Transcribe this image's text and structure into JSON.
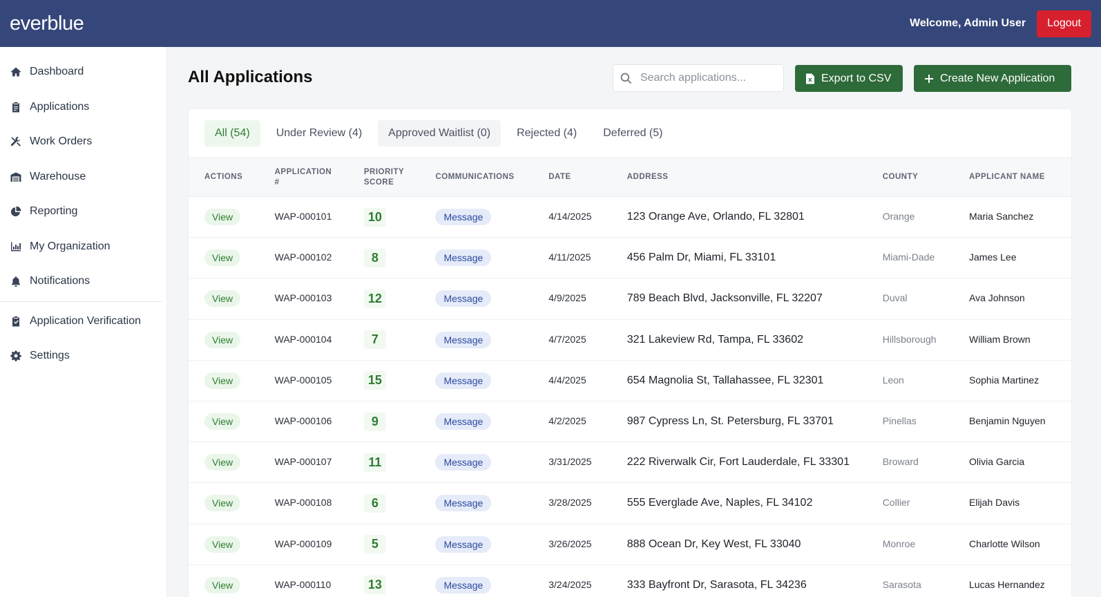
{
  "header": {
    "logo": "everblue",
    "welcome": "Welcome, Admin User",
    "logout_label": "Logout"
  },
  "sidebar": {
    "items": [
      {
        "label": "Dashboard",
        "icon": "home-icon"
      },
      {
        "label": "Applications",
        "icon": "clipboard-icon"
      },
      {
        "label": "Work Orders",
        "icon": "tools-icon"
      },
      {
        "label": "Warehouse",
        "icon": "warehouse-icon"
      },
      {
        "label": "Reporting",
        "icon": "pie-chart-icon"
      },
      {
        "label": "My Organization",
        "icon": "bar-chart-icon"
      },
      {
        "label": "Notifications",
        "icon": "bell-icon"
      },
      {
        "label": "Application Verification",
        "icon": "clipboard-check-icon"
      },
      {
        "label": "Settings",
        "icon": "gear-icon"
      }
    ]
  },
  "main": {
    "title": "All Applications",
    "search_placeholder": "Search applications...",
    "export_label": "Export to CSV",
    "create_label": "Create New Application",
    "tabs": [
      {
        "label": "All (54)"
      },
      {
        "label": "Under Review (4)"
      },
      {
        "label": "Approved Waitlist (0)"
      },
      {
        "label": "Rejected (4)"
      },
      {
        "label": "Deferred (5)"
      }
    ],
    "columns": {
      "actions": "ACTIONS",
      "app_line1": "APPLICATION",
      "app_line2": "#",
      "score_line1": "PRIORITY",
      "score_line2": "SCORE",
      "communications": "COMMUNICATIONS",
      "date": "DATE",
      "address": "ADDRESS",
      "county": "COUNTY",
      "name": "APPLICANT NAME"
    },
    "rows": [
      {
        "action": "View",
        "app": "WAP-000101",
        "score": "10",
        "comm": "Message",
        "date": "4/14/2025",
        "address": "123 Orange Ave, Orlando, FL 32801",
        "county": "Orange",
        "name": "Maria Sanchez"
      },
      {
        "action": "View",
        "app": "WAP-000102",
        "score": "8",
        "comm": "Message",
        "date": "4/11/2025",
        "address": "456 Palm Dr, Miami, FL 33101",
        "county": "Miami-Dade",
        "name": "James Lee"
      },
      {
        "action": "View",
        "app": "WAP-000103",
        "score": "12",
        "comm": "Message",
        "date": "4/9/2025",
        "address": "789 Beach Blvd, Jacksonville, FL 32207",
        "county": "Duval",
        "name": "Ava Johnson"
      },
      {
        "action": "View",
        "app": "WAP-000104",
        "score": "7",
        "comm": "Message",
        "date": "4/7/2025",
        "address": "321 Lakeview Rd, Tampa, FL 33602",
        "county": "Hillsborough",
        "name": "William Brown"
      },
      {
        "action": "View",
        "app": "WAP-000105",
        "score": "15",
        "comm": "Message",
        "date": "4/4/2025",
        "address": "654 Magnolia St, Tallahassee, FL 32301",
        "county": "Leon",
        "name": "Sophia Martinez"
      },
      {
        "action": "View",
        "app": "WAP-000106",
        "score": "9",
        "comm": "Message",
        "date": "4/2/2025",
        "address": "987 Cypress Ln, St. Petersburg, FL 33701",
        "county": "Pinellas",
        "name": "Benjamin Nguyen"
      },
      {
        "action": "View",
        "app": "WAP-000107",
        "score": "11",
        "comm": "Message",
        "date": "3/31/2025",
        "address": "222 Riverwalk Cir, Fort Lauderdale, FL 33301",
        "county": "Broward",
        "name": "Olivia Garcia"
      },
      {
        "action": "View",
        "app": "WAP-000108",
        "score": "6",
        "comm": "Message",
        "date": "3/28/2025",
        "address": "555 Everglade Ave, Naples, FL 34102",
        "county": "Collier",
        "name": "Elijah Davis"
      },
      {
        "action": "View",
        "app": "WAP-000109",
        "score": "5",
        "comm": "Message",
        "date": "3/26/2025",
        "address": "888 Ocean Dr, Key West, FL 33040",
        "county": "Monroe",
        "name": "Charlotte Wilson"
      },
      {
        "action": "View",
        "app": "WAP-000110",
        "score": "13",
        "comm": "Message",
        "date": "3/24/2025",
        "address": "333 Bayfront Dr, Sarasota, FL 34236",
        "county": "Sarasota",
        "name": "Lucas Hernandez"
      }
    ]
  },
  "colors": {
    "header_bg": "#35477a",
    "logout_bg": "#d7202e",
    "primary_green": "#2e6b3a",
    "view_green": "#2e7d32",
    "message_blue": "#2c4aa0"
  }
}
